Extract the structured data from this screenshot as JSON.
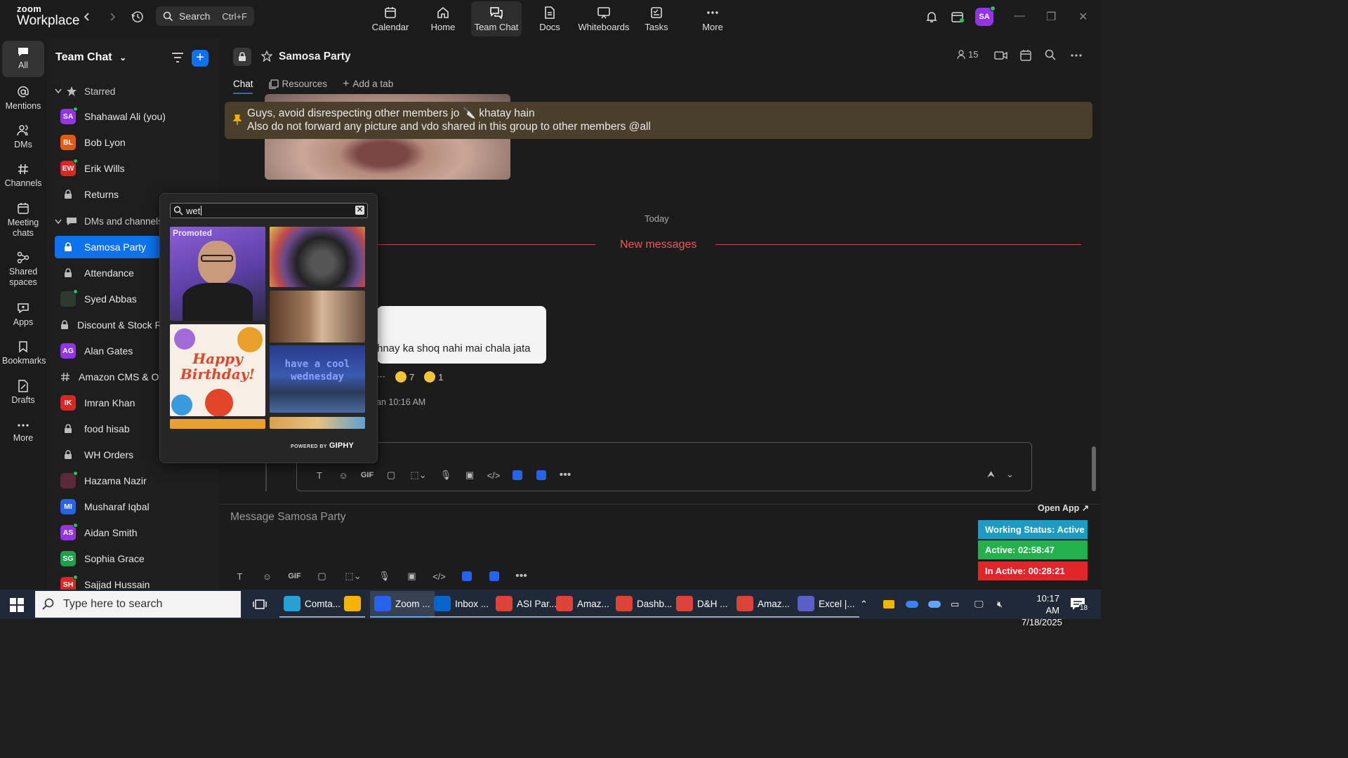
{
  "app": {
    "logo_line1": "zoom",
    "logo_line2": "Workplace"
  },
  "search": {
    "label": "Search",
    "shortcut": "Ctrl+F"
  },
  "nav_tabs": [
    {
      "label": "Calendar",
      "icon": "calendar-icon"
    },
    {
      "label": "Home",
      "icon": "home-icon"
    },
    {
      "label": "Team Chat",
      "icon": "chat-icon",
      "active": true
    },
    {
      "label": "Docs",
      "icon": "docs-icon"
    },
    {
      "label": "Whiteboards",
      "icon": "whiteboard-icon"
    },
    {
      "label": "Tasks",
      "icon": "tasks-icon"
    },
    {
      "label": "More",
      "icon": "more-icon"
    }
  ],
  "profile": {
    "initials": "SA",
    "color": "#9333ea"
  },
  "rail": [
    {
      "label": "All",
      "icon": "chat-bubble-icon",
      "active": true
    },
    {
      "label": "Mentions",
      "icon": "at-icon"
    },
    {
      "label": "DMs",
      "icon": "people-icon"
    },
    {
      "label": "Channels",
      "icon": "hash-icon"
    },
    {
      "label": "Meeting chats",
      "icon": "calendar-icon"
    },
    {
      "label": "Shared spaces",
      "icon": "share-icon"
    },
    {
      "label": "Apps",
      "icon": "apps-icon"
    },
    {
      "label": "Bookmarks",
      "icon": "bookmark-icon"
    },
    {
      "label": "Drafts",
      "icon": "drafts-icon"
    },
    {
      "label": "More",
      "icon": "more-dots-icon"
    }
  ],
  "chanlist": {
    "title": "Team Chat",
    "starred_label": "Starred",
    "starred": [
      {
        "name": "Shahawal Ali (you)",
        "initials": "SA",
        "color": "#9333ea",
        "type": "avatar",
        "online": true
      },
      {
        "name": "Bob Lyon",
        "initials": "BL",
        "color": "#ea580c",
        "type": "avatar",
        "online": false
      },
      {
        "name": "Erik Wills",
        "initials": "EW",
        "color": "#dc2626",
        "type": "avatar",
        "online": true
      },
      {
        "name": "Returns",
        "type": "lock"
      }
    ],
    "dms_label": "DMs and channels",
    "dms": [
      {
        "name": "Samosa Party",
        "type": "lock",
        "active": true
      },
      {
        "name": "Attendance",
        "type": "lock"
      },
      {
        "name": "Syed Abbas",
        "initials": "",
        "color": "#2f3a2f",
        "type": "avatar",
        "online": true
      },
      {
        "name": "Discount & Stock R",
        "type": "lock"
      },
      {
        "name": "Alan Gates",
        "initials": "AG",
        "color": "#9333ea",
        "type": "avatar",
        "online": false
      },
      {
        "name": "Amazon CMS & Or",
        "type": "hash"
      },
      {
        "name": "Imran Khan",
        "initials": "IK",
        "color": "#dc2626",
        "type": "avatar",
        "online": false
      },
      {
        "name": "food hisab",
        "type": "lock"
      },
      {
        "name": "WH Orders",
        "type": "lock"
      },
      {
        "name": "Hazama Nazir",
        "initials": "",
        "color": "#5b2a3a",
        "type": "avatar",
        "online": true
      },
      {
        "name": "Musharaf Iqbal",
        "initials": "MI",
        "color": "#2563eb",
        "type": "avatar",
        "online": false
      },
      {
        "name": "Aidan Smith",
        "initials": "AS",
        "color": "#9333ea",
        "type": "avatar",
        "online": true
      },
      {
        "name": "Sophia Grace",
        "initials": "SG",
        "color": "#16a34a",
        "type": "avatar",
        "online": false
      },
      {
        "name": "Sajjad Hussain",
        "initials": "SH",
        "color": "#dc2626",
        "type": "avatar",
        "online": true
      }
    ]
  },
  "chat": {
    "title": "Samosa Party",
    "member_count": "15",
    "tabs": [
      "Chat",
      "Resources",
      "Add a tab"
    ],
    "pinned_line1": "Guys, avoid disrespecting other members jo 🔪 khatay hain",
    "pinned_line2": "Also do not forward any picture and vdo shared in this group to other members @all",
    "today_label": "Today",
    "new_messages_label": "New messages",
    "message_text": "hnay ka shoq nahi mai chala jata",
    "reaction1_count": "7",
    "reaction2_count": "1",
    "message_time": "an 10:16 AM",
    "input_placeholder": "Message Samosa Party"
  },
  "gif_picker": {
    "query": "wet",
    "promoted_label": "Promoted",
    "gif_text_birthday": "Happy Birthday!",
    "gif_text_wednesday": "have a cool wednesday",
    "powered_by": "POWERED BY",
    "brand": "GIPHY"
  },
  "status_widget": {
    "open_app": "Open App ↗",
    "working_status": "Working Status: Active",
    "active_time": "Active: 02:58:47",
    "inactive_time": "In Active: 00:28:21",
    "colors": {
      "working": "#1e9bc4",
      "active": "#22b14c",
      "inactive": "#e0262a"
    }
  },
  "taskbar": {
    "search_placeholder": "Type here to search",
    "apps": [
      {
        "label": "Comta...",
        "color": "#2a9fd6"
      },
      {
        "label": "",
        "color": "#f5b400"
      },
      {
        "label": "Zoom ...",
        "color": "#2563eb",
        "active": true
      },
      {
        "label": "Inbox ...",
        "color": "#0a64c8"
      },
      {
        "label": "ASI Par...",
        "color": "#db4437"
      },
      {
        "label": "Amaz...",
        "color": "#db4437"
      },
      {
        "label": "Dashb...",
        "color": "#db4437"
      },
      {
        "label": "D&H ...",
        "color": "#db4437"
      },
      {
        "label": "Amaz...",
        "color": "#db4437"
      },
      {
        "label": "Excel |...",
        "color": "#5b5fc7"
      }
    ],
    "time": "10:17 AM",
    "date": "7/18/2025",
    "notif_count": "18"
  }
}
